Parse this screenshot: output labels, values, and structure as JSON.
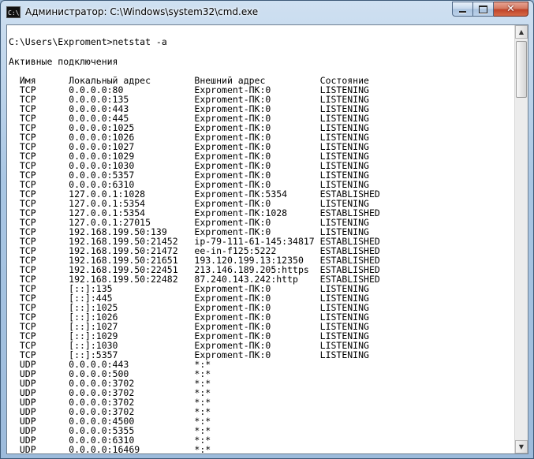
{
  "window": {
    "title": "Администратор: C:\\Windows\\system32\\cmd.exe",
    "icon_label": "C:\\",
    "controls": {
      "minimize": "minimize-icon",
      "maximize": "maximize-icon",
      "close": "close-icon"
    }
  },
  "console": {
    "prompt": "C:\\Users\\Exproment>netstat -a",
    "heading": "Активные подключения",
    "columns": [
      "Имя",
      "Локальный адрес",
      "Внешний адрес",
      "Состояние"
    ],
    "rows": [
      [
        "TCP",
        "0.0.0.0:80",
        "Exproment-ПК:0",
        "LISTENING"
      ],
      [
        "TCP",
        "0.0.0.0:135",
        "Exproment-ПК:0",
        "LISTENING"
      ],
      [
        "TCP",
        "0.0.0.0:443",
        "Exproment-ПК:0",
        "LISTENING"
      ],
      [
        "TCP",
        "0.0.0.0:445",
        "Exproment-ПК:0",
        "LISTENING"
      ],
      [
        "TCP",
        "0.0.0.0:1025",
        "Exproment-ПК:0",
        "LISTENING"
      ],
      [
        "TCP",
        "0.0.0.0:1026",
        "Exproment-ПК:0",
        "LISTENING"
      ],
      [
        "TCP",
        "0.0.0.0:1027",
        "Exproment-ПК:0",
        "LISTENING"
      ],
      [
        "TCP",
        "0.0.0.0:1029",
        "Exproment-ПК:0",
        "LISTENING"
      ],
      [
        "TCP",
        "0.0.0.0:1030",
        "Exproment-ПК:0",
        "LISTENING"
      ],
      [
        "TCP",
        "0.0.0.0:5357",
        "Exproment-ПК:0",
        "LISTENING"
      ],
      [
        "TCP",
        "0.0.0.0:6310",
        "Exproment-ПК:0",
        "LISTENING"
      ],
      [
        "TCP",
        "127.0.0.1:1028",
        "Exproment-ПК:5354",
        "ESTABLISHED"
      ],
      [
        "TCP",
        "127.0.0.1:5354",
        "Exproment-ПК:0",
        "LISTENING"
      ],
      [
        "TCP",
        "127.0.0.1:5354",
        "Exproment-ПК:1028",
        "ESTABLISHED"
      ],
      [
        "TCP",
        "127.0.0.1:27015",
        "Exproment-ПК:0",
        "LISTENING"
      ],
      [
        "TCP",
        "192.168.199.50:139",
        "Exproment-ПК:0",
        "LISTENING"
      ],
      [
        "TCP",
        "192.168.199.50:21452",
        "ip-79-111-61-145:34817",
        "ESTABLISHED"
      ],
      [
        "TCP",
        "192.168.199.50:21472",
        "ee-in-f125:5222",
        "ESTABLISHED"
      ],
      [
        "TCP",
        "192.168.199.50:21651",
        "193.120.199.13:12350",
        "ESTABLISHED"
      ],
      [
        "TCP",
        "192.168.199.50:22451",
        "213.146.189.205:https",
        "ESTABLISHED"
      ],
      [
        "TCP",
        "192.168.199.50:22482",
        "87.240.143.242:http",
        "ESTABLISHED"
      ],
      [
        "TCP",
        "[::]:135",
        "Exproment-ПК:0",
        "LISTENING"
      ],
      [
        "TCP",
        "[::]:445",
        "Exproment-ПК:0",
        "LISTENING"
      ],
      [
        "TCP",
        "[::]:1025",
        "Exproment-ПК:0",
        "LISTENING"
      ],
      [
        "TCP",
        "[::]:1026",
        "Exproment-ПК:0",
        "LISTENING"
      ],
      [
        "TCP",
        "[::]:1027",
        "Exproment-ПК:0",
        "LISTENING"
      ],
      [
        "TCP",
        "[::]:1029",
        "Exproment-ПК:0",
        "LISTENING"
      ],
      [
        "TCP",
        "[::]:1030",
        "Exproment-ПК:0",
        "LISTENING"
      ],
      [
        "TCP",
        "[::]:5357",
        "Exproment-ПК:0",
        "LISTENING"
      ],
      [
        "UDP",
        "0.0.0.0:443",
        "*:*",
        ""
      ],
      [
        "UDP",
        "0.0.0.0:500",
        "*:*",
        ""
      ],
      [
        "UDP",
        "0.0.0.0:3702",
        "*:*",
        ""
      ],
      [
        "UDP",
        "0.0.0.0:3702",
        "*:*",
        ""
      ],
      [
        "UDP",
        "0.0.0.0:3702",
        "*:*",
        ""
      ],
      [
        "UDP",
        "0.0.0.0:3702",
        "*:*",
        ""
      ],
      [
        "UDP",
        "0.0.0.0:4500",
        "*:*",
        ""
      ],
      [
        "UDP",
        "0.0.0.0:5355",
        "*:*",
        ""
      ],
      [
        "UDP",
        "0.0.0.0:6310",
        "*:*",
        ""
      ],
      [
        "UDP",
        "0.0.0.0:16469",
        "*:*",
        ""
      ]
    ]
  },
  "scrollbar": {
    "up_icon": "scroll-up-arrow-icon",
    "down_icon": "scroll-down-arrow-icon"
  }
}
